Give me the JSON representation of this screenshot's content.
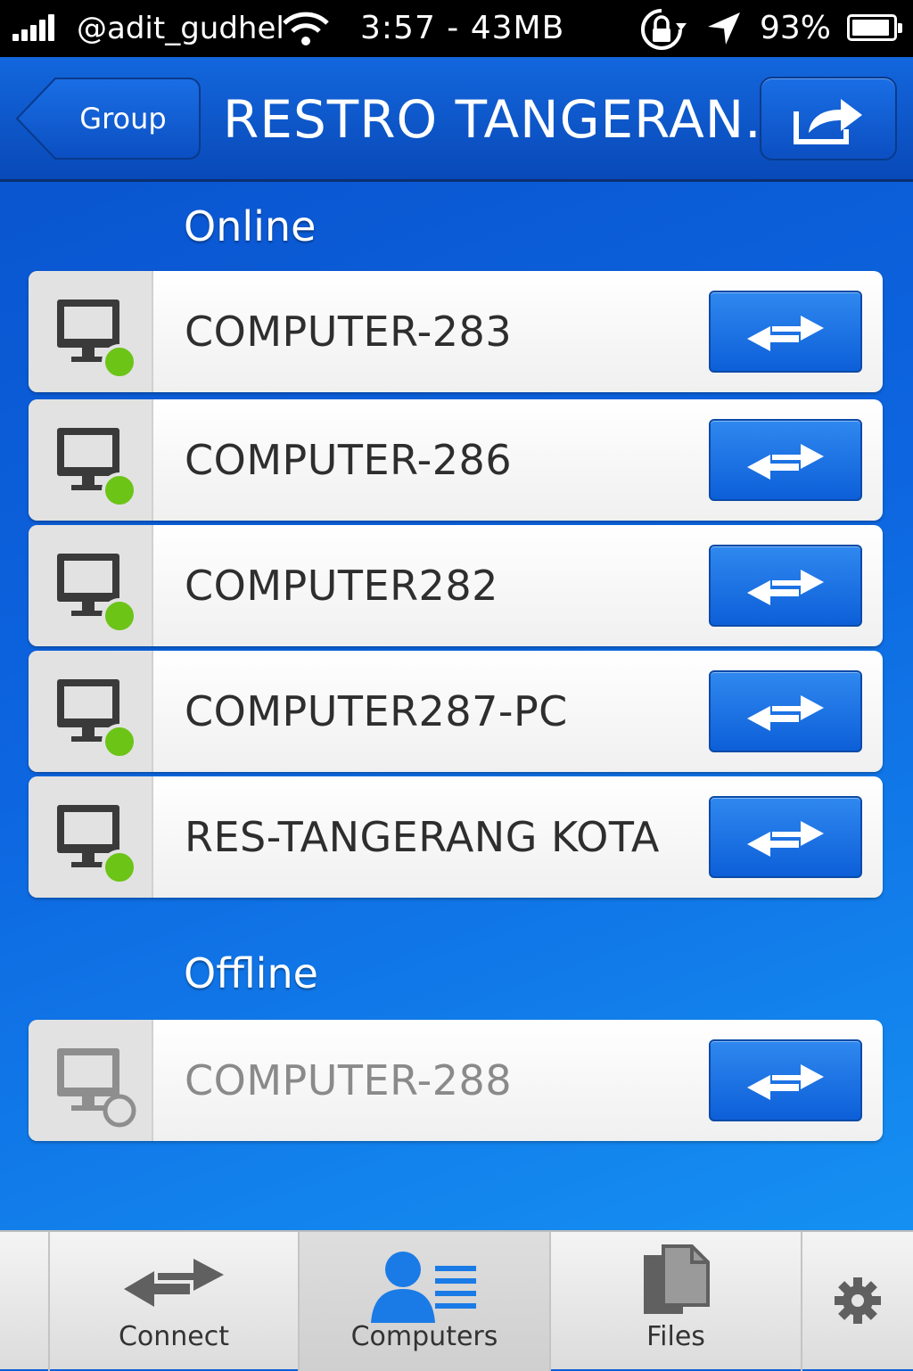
{
  "status_bar": {
    "carrier": "@adit_gudhel",
    "time_memory": "3:57 - 43MB",
    "battery": "93%",
    "battery_level": 0.93
  },
  "nav": {
    "back_label": "Group",
    "title": "RESTRO TANGERAN..."
  },
  "sections": {
    "online_heading": "Online",
    "offline_heading": "Offline"
  },
  "online_computers": [
    {
      "name": "COMPUTER-283"
    },
    {
      "name": "COMPUTER-286"
    },
    {
      "name": "COMPUTER282"
    },
    {
      "name": "COMPUTER287-PC"
    },
    {
      "name": "RES-TANGERANG KOTA"
    }
  ],
  "offline_computers": [
    {
      "name": "COMPUTER-288"
    }
  ],
  "tabs": {
    "connect": "Connect",
    "computers": "Computers",
    "files": "Files"
  },
  "colors": {
    "online_dot": "#6cc417",
    "accent_blue": "#0d5fd8"
  }
}
